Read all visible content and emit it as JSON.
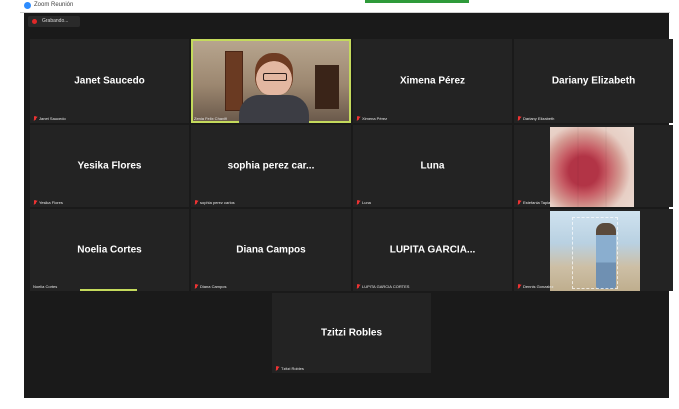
{
  "window": {
    "title": "Zoom Reunión",
    "accent": "#2e9a3a"
  },
  "recording": {
    "label": "Grabando..."
  },
  "colors": {
    "stage": "#1a1a1a",
    "tile": "#232323",
    "active_border": "#c4da5c",
    "muted": "#e33333"
  },
  "tiles": [
    {
      "display": "Janet Saucedo",
      "label": "Janet Saucedo",
      "muted": true
    },
    {
      "display": "",
      "label": "Zenia Felix Chaviñ",
      "muted": false,
      "video": true
    },
    {
      "display": "Ximena Pérez",
      "label": "Ximena Pérez",
      "muted": true
    },
    {
      "display": "Dariany Elizabeth",
      "label": "Dariany Elizabeth",
      "muted": true
    },
    {
      "display": "Yesika Flores",
      "label": "Yesika Flores",
      "muted": true
    },
    {
      "display": "sophia perez car...",
      "label": "sophia perez carlos",
      "muted": true
    },
    {
      "display": "Luna",
      "label": "Luna",
      "muted": true
    },
    {
      "display": "",
      "label": "Estefania Tapia",
      "muted": true,
      "video": true
    },
    {
      "display": "Noelia Cortes",
      "label": "Noelia Cortes",
      "muted": false
    },
    {
      "display": "Diana Campos",
      "label": "Diana Campos",
      "muted": true
    },
    {
      "display": "LUPITA GARCIA...",
      "label": "LUPITA GARCIA CORTES",
      "muted": true
    },
    {
      "display": "",
      "label": "Dennis Gonzalez",
      "muted": true,
      "video": true
    },
    {
      "display": "Tzitzi Robles",
      "label": "Tzitzi Robles",
      "muted": true
    }
  ]
}
